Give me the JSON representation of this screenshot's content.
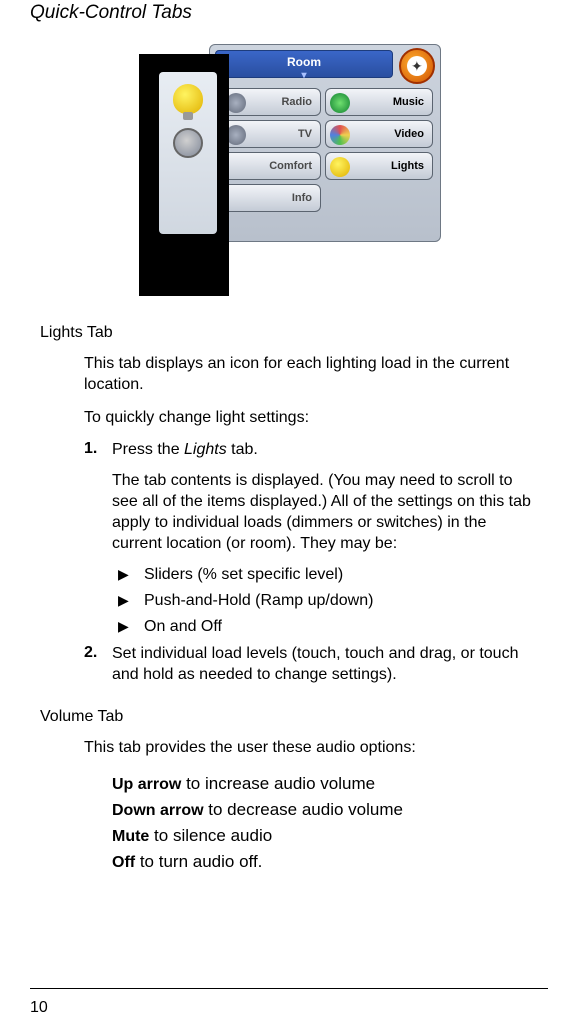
{
  "header": "Quick-Control Tabs",
  "device": {
    "room_label": "Room",
    "buttons": {
      "radio": "Radio",
      "tv": "TV",
      "comfort": "Comfort",
      "info": "Info",
      "music": "Music",
      "video": "Video",
      "lights": "Lights"
    }
  },
  "lights": {
    "label": "Lights Tab",
    "intro": "This tab displays an icon for each lighting load in the current location.",
    "howto": "To quickly change light settings:",
    "step1_num": "1.",
    "step1_text_a": "Press the ",
    "step1_text_b": "Lights",
    "step1_text_c": " tab.",
    "step1_detail": "The tab contents is displayed. (You may need to scroll to see all of the items displayed.) All of the settings on this tab apply to individual loads (dimmers or switches) in the current location (or room). They may be:",
    "bullets": [
      "Sliders (% set specific level)",
      "Push-and-Hold (Ramp up/down)",
      "On and Off"
    ],
    "step2_num": "2.",
    "step2_text": "Set individual load levels (touch, touch and drag, or touch and hold as needed to change settings)."
  },
  "volume": {
    "label": "Volume Tab",
    "intro": "This tab provides the user these audio options:",
    "opts": [
      {
        "bold": "Up arrow",
        "rest": " to increase audio volume"
      },
      {
        "bold": "Down arrow",
        "rest": " to decrease audio volume"
      },
      {
        "bold": "Mute",
        "rest": " to silence audio"
      },
      {
        "bold": "Off",
        "rest": " to turn audio off."
      }
    ]
  },
  "page_number": "10"
}
